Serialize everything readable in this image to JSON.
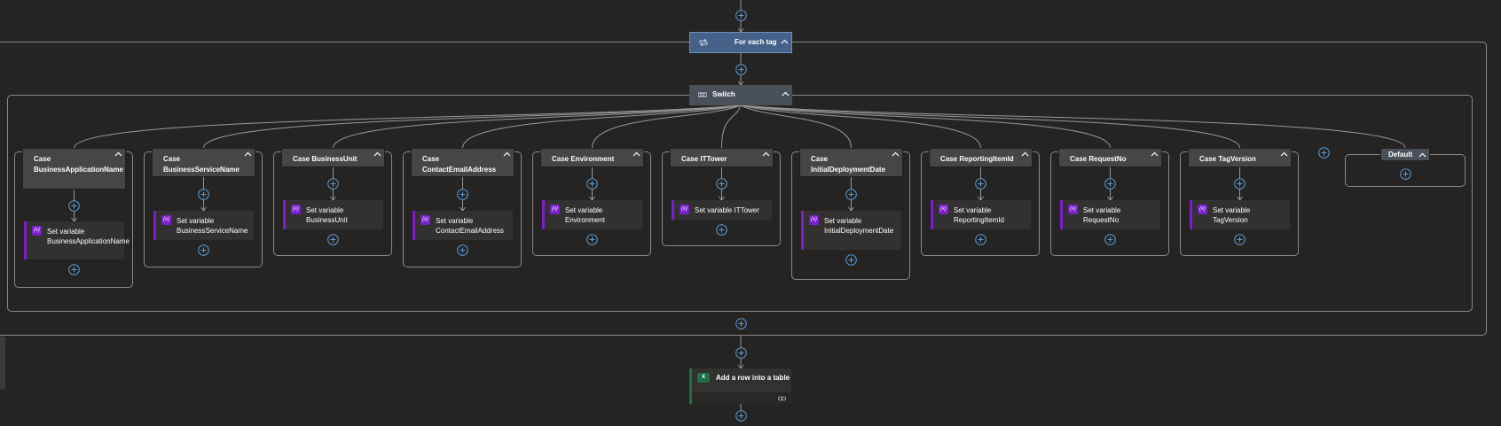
{
  "foreach": {
    "label": "For each tag"
  },
  "switch": {
    "label": "Switch"
  },
  "cases": [
    {
      "label": "Case BusinessApplicationName",
      "action": "Set variable BusinessApplicationName"
    },
    {
      "label": "Case BusinessServiceName",
      "action": "Set variable BusinessServiceName"
    },
    {
      "label": "Case BusinessUnit",
      "action": "Set variable BusinessUnit"
    },
    {
      "label": "Case ContactEmailAddress",
      "action": "Set variable ContactEmailAddress"
    },
    {
      "label": "Case Environment",
      "action": "Set variable Environment"
    },
    {
      "label": "Case ITTower",
      "action": "Set variable ITTower"
    },
    {
      "label": "Case InitialDeploymentDate",
      "action": "Set variable InitialDeploymentDate"
    },
    {
      "label": "Case ReportingItemId",
      "action": "Set variable ReportingItemId"
    },
    {
      "label": "Case RequestNo",
      "action": "Set variable RequestNo"
    },
    {
      "label": "Case TagVersion",
      "action": "Set variable TagVersion"
    }
  ],
  "default": {
    "label": "Default"
  },
  "excel_action": {
    "label": "Add a row into a table",
    "icon_text": "X"
  },
  "icons": {
    "variable": "{x}"
  },
  "colors": {
    "foreach": "#45618a",
    "variable": "#7a1fcf",
    "excel": "#1e7145",
    "plus": "#5b9bd5"
  }
}
